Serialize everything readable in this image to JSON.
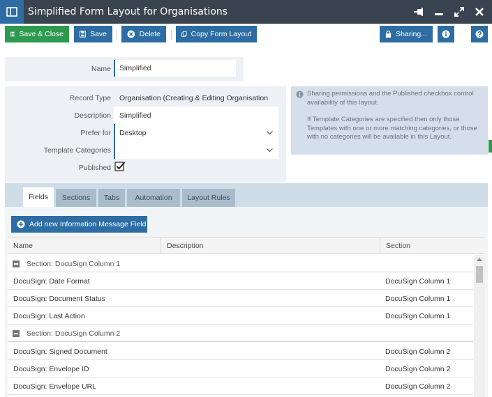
{
  "window": {
    "title": "Simplified Form Layout for Organisations"
  },
  "toolbar": {
    "save_close": "Save & Close",
    "save": "Save",
    "delete": "Delete",
    "copy_form_layout": "Copy Form Layout",
    "sharing": "Sharing..."
  },
  "form": {
    "name_label": "Name",
    "name_value": "Simplified",
    "record_type_label": "Record Type",
    "record_type_value": "Organisation (Creating & Editing Organisation",
    "description_label": "Description",
    "description_value": "Simplified",
    "prefer_for_label": "Prefer for",
    "prefer_for_value": "Desktop",
    "template_categories_label": "Template Categories",
    "template_categories_value": "",
    "published_label": "Published",
    "published_checked": true
  },
  "info": {
    "line1": "Sharing permissions and the Published checkbox control availability of this layout.",
    "line2": "If Template Categories are specified then only those Templates with one or more matching categories, or those with no categories will be available in this Layout."
  },
  "tabs": [
    "Fields",
    "Sections",
    "Tabs",
    "Automation",
    "Layout Rules"
  ],
  "active_tab": "Fields",
  "add_field_button": "Add new Information Message Field",
  "grid": {
    "columns": [
      "Name",
      "Description",
      "Section"
    ],
    "rows": [
      {
        "type": "group",
        "name": "Section: DocuSign Column 1"
      },
      {
        "type": "item",
        "name": "DocuSign: Date Format",
        "description": "",
        "section": "DocuSign Column 1"
      },
      {
        "type": "item",
        "name": "DocuSign: Document Status",
        "description": "",
        "section": "DocuSign Column 1"
      },
      {
        "type": "item",
        "name": "DocuSign: Last Action",
        "description": "",
        "section": "DocuSign Column 1"
      },
      {
        "type": "group",
        "name": "Section: DocuSign Column 2"
      },
      {
        "type": "item",
        "name": "DocuSign: Signed Document",
        "description": "",
        "section": "DocuSign Column 2"
      },
      {
        "type": "item",
        "name": "DocuSign: Envelope ID",
        "description": "",
        "section": "DocuSign Column 2"
      },
      {
        "type": "item",
        "name": "DocuSign: Envelope URL",
        "description": "",
        "section": "DocuSign Column 2"
      }
    ]
  },
  "colors": {
    "titlebar": "#3a4450",
    "primary": "#2d6da3",
    "success": "#2e9a4f",
    "panel": "#edf1f6",
    "info_panel": "#d4dfeb"
  }
}
